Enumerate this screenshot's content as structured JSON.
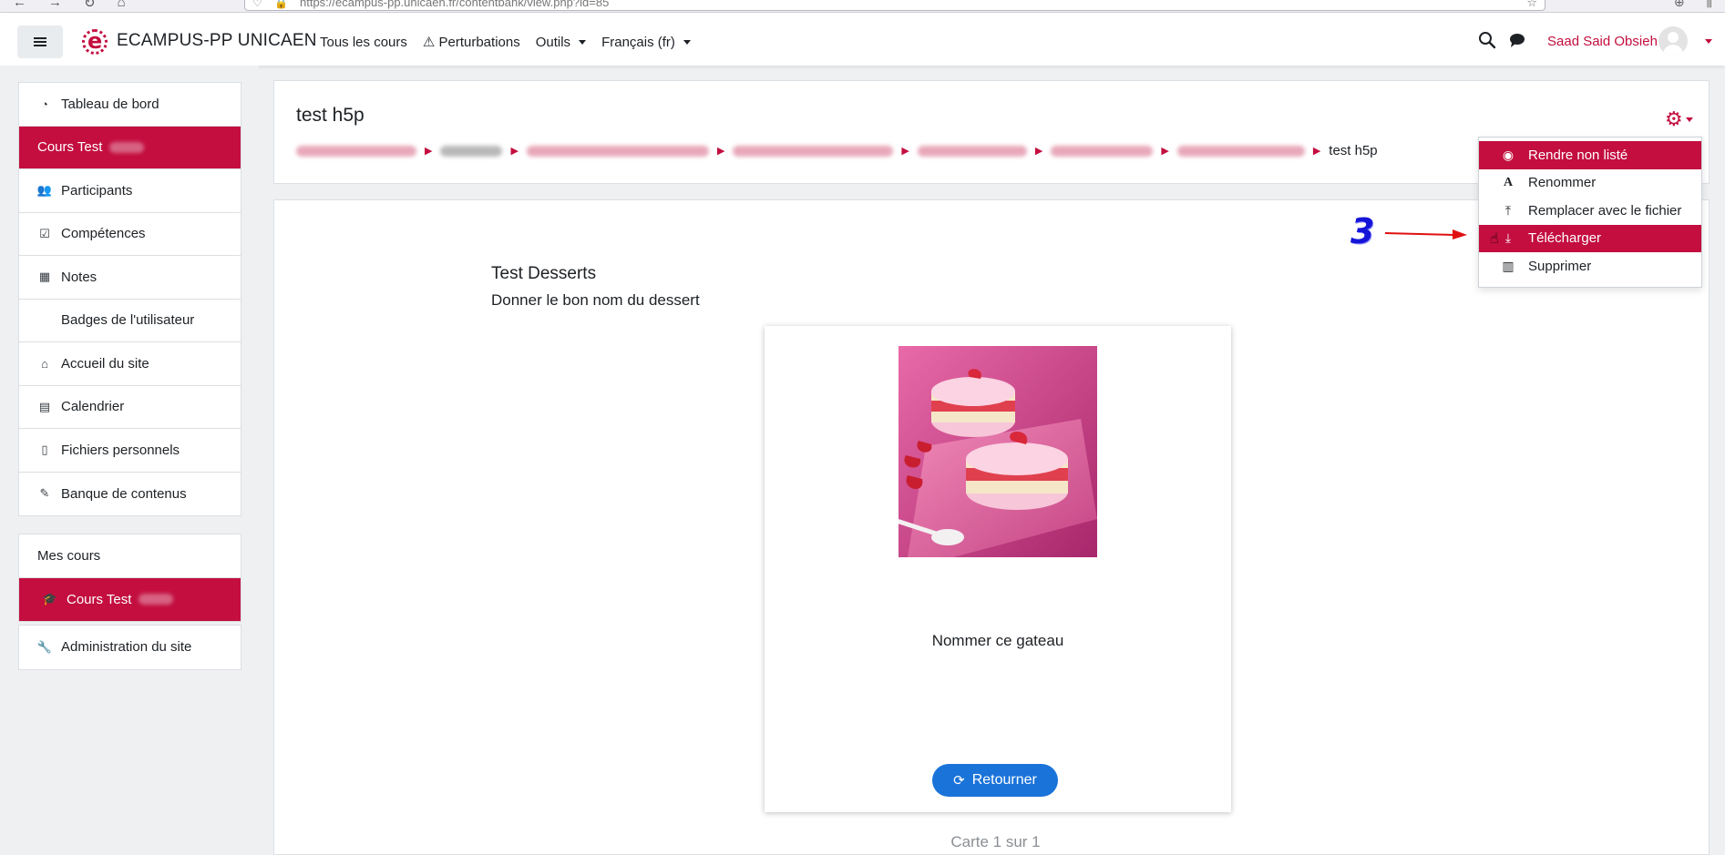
{
  "browser": {
    "url": "https://ecampus-pp.unicaen.fr/contentbank/view.php?id=85"
  },
  "navbar": {
    "brand": "ECAMPUS-PP UNICAEN",
    "menu": [
      {
        "label": "Tous les cours",
        "dropdown": false
      },
      {
        "label": "⚠ Perturbations",
        "dropdown": false
      },
      {
        "label": "Outils",
        "dropdown": true
      },
      {
        "label": "Français (fr)",
        "dropdown": true
      }
    ],
    "user_name": "Saad Said Obsieh",
    "accent_color": "#c30e3f"
  },
  "sidebar": {
    "main": [
      {
        "label": "Tableau de bord",
        "icon": "dashboard-icon",
        "glyph": "◔",
        "active": false,
        "indent": false
      },
      {
        "label": "Cours Test",
        "icon": "",
        "glyph": "",
        "active": true,
        "indent": false,
        "blurred_suffix": true
      },
      {
        "label": "Participants",
        "icon": "users-icon",
        "glyph": "👥",
        "active": false,
        "indent": false
      },
      {
        "label": "Compétences",
        "icon": "checkbox-icon",
        "glyph": "☑",
        "active": false,
        "indent": false
      },
      {
        "label": "Notes",
        "icon": "table-icon",
        "glyph": "▦",
        "active": false,
        "indent": false
      },
      {
        "label": "Badges de l'utilisateur",
        "icon": "",
        "glyph": "",
        "active": false,
        "indent": true
      },
      {
        "label": "Accueil du site",
        "icon": "home-icon",
        "glyph": "⌂",
        "active": false,
        "indent": false
      },
      {
        "label": "Calendrier",
        "icon": "calendar-icon",
        "glyph": "▤",
        "active": false,
        "indent": false
      },
      {
        "label": "Fichiers personnels",
        "icon": "file-icon",
        "glyph": "▯",
        "active": false,
        "indent": false
      },
      {
        "label": "Banque de contenus",
        "icon": "brush-icon",
        "glyph": "✎",
        "active": false,
        "indent": false
      }
    ],
    "courses_header": "Mes cours",
    "course_item": "Cours Test",
    "admin": "Administration du site"
  },
  "header": {
    "page_title": "test h5p",
    "breadcrumb_current": "test h5p"
  },
  "dropdown": {
    "items": [
      {
        "label": "Rendre non listé",
        "icon": "eye-slash-icon",
        "glyph": "◉",
        "highlighted": true
      },
      {
        "label": "Renommer",
        "icon": "font-icon",
        "glyph": "A",
        "highlighted": false
      },
      {
        "label": "Remplacer avec le fichier",
        "icon": "upload-icon",
        "glyph": "⤒",
        "highlighted": false
      },
      {
        "label": "Télécharger",
        "icon": "download-icon",
        "glyph": "⤓",
        "highlighted": true
      },
      {
        "label": "Supprimer",
        "icon": "trash-icon",
        "glyph": "🗑",
        "highlighted": false
      }
    ]
  },
  "annotation": {
    "number": "3",
    "arrow_color": "#e01010",
    "number_color": "#1515d8"
  },
  "h5p": {
    "title": "Test Desserts",
    "subtitle": "Donner le bon nom du dessert",
    "card_question": "Nommer ce gateau",
    "flip_button": "Retourner",
    "counter": "Carte 1 sur 1",
    "button_color": "#1a73d9"
  }
}
